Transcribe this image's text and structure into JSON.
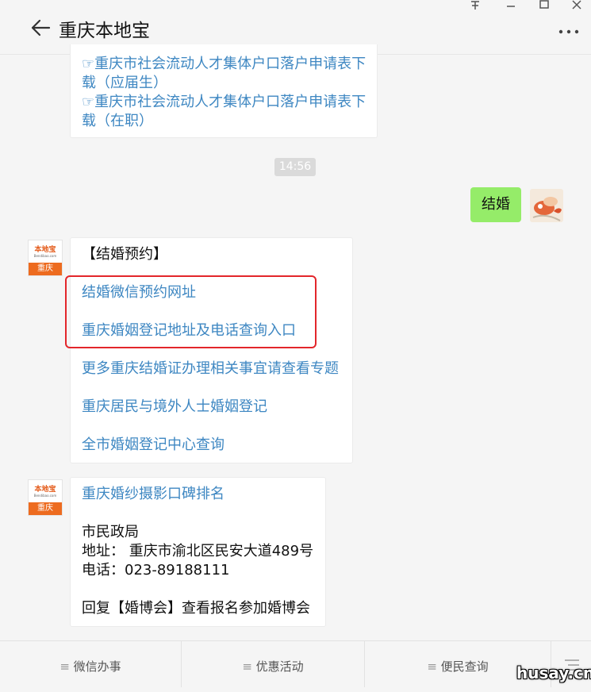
{
  "header": {
    "title": "重庆本地宝",
    "pin_icon": "pin-icon",
    "minimize_icon": "minimize-icon",
    "maximize_icon": "maximize-icon",
    "close_icon": "close-icon",
    "more_icon": "more-icon",
    "back_icon": "back-arrow-icon"
  },
  "messages": {
    "top_card": {
      "lines": [
        "☞重庆市社会流动人才集体户口落户申请表下",
        "载（应届生）",
        "☞重庆市社会流动人才集体户口落户申请表下",
        "载（在职）"
      ]
    },
    "timestamp": "14:56",
    "user_message": "结婚",
    "account_logo": {
      "brand": "本地宝",
      "url": "Bendibao.com",
      "city": "重庆"
    },
    "marriage_card": {
      "heading": "【结婚预约】",
      "links": [
        "结婚微信预约网址",
        "重庆婚姻登记地址及电话查询入口",
        "更多重庆结婚证办理相关事宜请查看专题",
        "重庆居民与境外人士婚姻登记",
        "全市婚姻登记中心查询"
      ]
    },
    "photo_card": {
      "link": "重庆婚纱摄影口碑排名",
      "lines": [
        "市民政局",
        "地址： 重庆市渝北区民安大道489号",
        "电话：023-89188111",
        "",
        "回复【婚博会】查看报名参加婚博会"
      ]
    }
  },
  "tabbar": {
    "tabs": [
      "微信办事",
      "优惠活动",
      "便民查询"
    ],
    "menu_icon": "menu-lines-icon",
    "keyboard_icon": "keyboard-toggle-icon"
  },
  "watermark": "husay.cn",
  "colors": {
    "link": "#3e87c2",
    "user_bubble": "#95ec69",
    "highlight_box": "#e3262b",
    "brand_orange": "#ed6b1f"
  }
}
